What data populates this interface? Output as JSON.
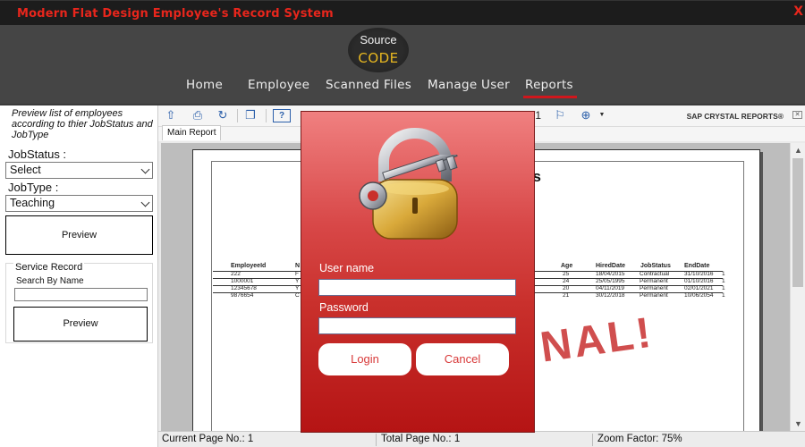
{
  "window": {
    "title": "Modern Flat Design Employee's Record System",
    "close_label": "X"
  },
  "logo": {
    "line1": "Source",
    "line2": "CODE"
  },
  "nav": {
    "items": [
      {
        "label": "Home"
      },
      {
        "label": "Employee"
      },
      {
        "label": "Scanned Files"
      },
      {
        "label": "Manage User"
      },
      {
        "label": "Reports",
        "active": true
      }
    ]
  },
  "left": {
    "description": "Preview list of employees according to thier JobStatus and JobType",
    "jobstatus_label": "JobStatus :",
    "jobstatus_value": "Select",
    "jobtype_label": "JobType :",
    "jobtype_value": "Teaching",
    "preview_label": "Preview",
    "service_record": {
      "title": "Service Record",
      "search_label": "Search By Name",
      "search_value": "",
      "preview_label": "Preview"
    }
  },
  "viewer": {
    "brand": "SAP CRYSTAL REPORTS®",
    "page_indicator": "/1",
    "tab": "Main Report",
    "report_title_partial": "es",
    "columns_left": [
      "EmployeeId",
      "N"
    ],
    "columns_right": [
      "Age",
      "HiredDate",
      "JobStatus",
      "EndDate"
    ],
    "rows": [
      {
        "id": "222",
        "n": "F",
        "age": "25",
        "hired": "18/04/2015",
        "status": "Contractual",
        "end": "31/10/2016",
        "flag": "1"
      },
      {
        "id": "1000001",
        "n": "Y",
        "age": "24",
        "hired": "25/05/1995",
        "status": "Permanent",
        "end": "01/10/2016",
        "flag": "1"
      },
      {
        "id": "12345678",
        "n": "Y",
        "age": "20",
        "hired": "04/11/2019",
        "status": "Permanent",
        "end": "02/01/2021",
        "flag": "1"
      },
      {
        "id": "9876654",
        "n": "C",
        "age": "21",
        "hired": "30/12/2018",
        "status": "Permanent",
        "end": "10/06/2054",
        "flag": "1"
      }
    ],
    "stamp_partial": "NAL!",
    "status": {
      "current_page": "Current Page No.: 1",
      "total_page": "Total Page No.: 1",
      "zoom": "Zoom Factor: 75%"
    }
  },
  "login": {
    "username_label": "User name",
    "username_value": "",
    "password_label": "Password",
    "password_value": "",
    "login_label": "Login",
    "cancel_label": "Cancel"
  },
  "colors": {
    "title_red": "#e8261c",
    "nav_active_underline": "#d0161c",
    "dialog_top": "#f08080",
    "dialog_bottom": "#b51414",
    "logo_code": "#e8b820"
  },
  "icons": [
    "export-icon",
    "print-icon",
    "refresh-icon",
    "copy-icon",
    "help-icon",
    "binoculars-icon",
    "zoom-icon",
    "chevron-down-icon",
    "padlock-icon",
    "key-icon"
  ]
}
